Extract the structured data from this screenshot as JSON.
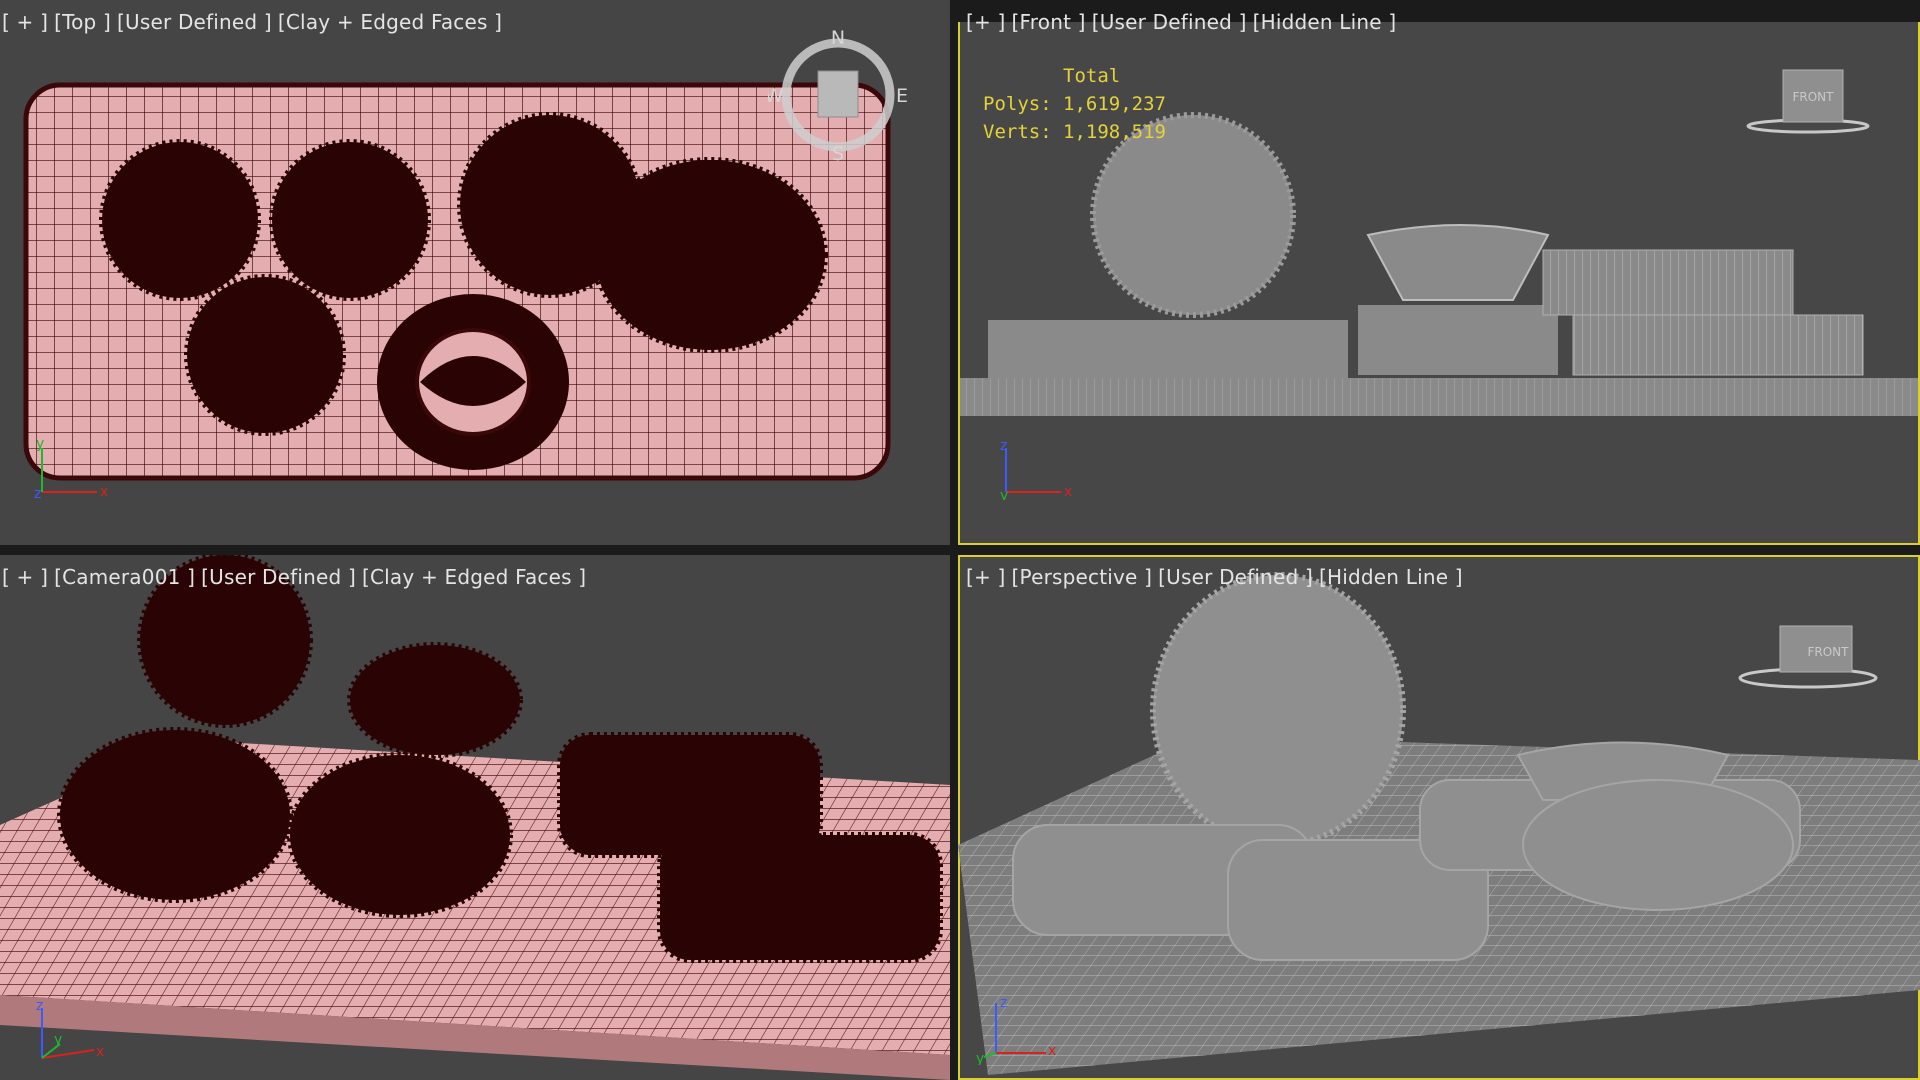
{
  "viewports": [
    {
      "id": "top",
      "label": [
        "[ + ]",
        "[Top ]",
        "[User Defined ]",
        "[Clay + Edged Faces ]"
      ]
    },
    {
      "id": "front",
      "label": [
        "[+ ]",
        "[Front ]",
        "[User Defined ]",
        "[Hidden Line ]"
      ]
    },
    {
      "id": "camera",
      "label": [
        "[ + ]",
        "[Camera001 ]",
        "[User Defined ]",
        "[Clay + Edged Faces ]"
      ]
    },
    {
      "id": "perspective",
      "label": [
        "[+ ]",
        "[Perspective ]",
        "[User Defined ]",
        "[Hidden Line ]"
      ]
    }
  ],
  "stats": {
    "title": "Total",
    "polys_label": "Polys:",
    "polys": "1,619,237",
    "verts_label": "Verts:",
    "verts": "1,198,519"
  },
  "compass": {
    "n": "N",
    "s": "S",
    "e": "E",
    "w": "W"
  },
  "viewcube": {
    "front_label": "FRONT"
  },
  "axes": {
    "x": "x",
    "y": "y",
    "z": "z"
  },
  "colors": {
    "active_border": "#d9cf2e",
    "clay": "#e4aeb0",
    "wire": "#3a0808",
    "hidden": "#8a8a8a",
    "bg": "#454545"
  }
}
